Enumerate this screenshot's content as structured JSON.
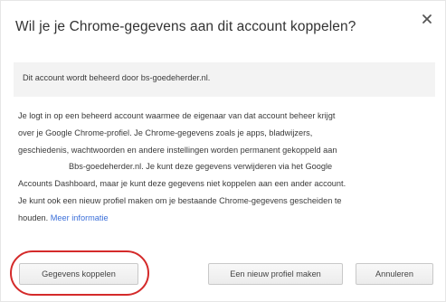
{
  "dialog": {
    "title": "Wil je je Chrome-gegevens aan dit account koppelen?",
    "close_icon": "close-icon",
    "managed_notice": "Dit account wordt beheerd door bs-goedeherder.nl.",
    "body": {
      "line1": "Je logt in op een beheerd account waarmee de eigenaar van dat account beheer krijgt",
      "line2": "over je Google Chrome-profiel. Je Chrome-gegevens zoals je apps, bladwijzers,",
      "line3": "geschiedenis, wachtwoorden en andere instellingen worden permanent gekoppeld aan",
      "line4": "Bbs-goedeherder.nl. Je kunt deze gegevens verwijderen via het Google",
      "line5": "Accounts Dashboard, maar je kunt deze gegevens niet koppelen aan een ander account.",
      "line6": "Je kunt ook een nieuw profiel maken om je bestaande Chrome-gegevens gescheiden te",
      "line7_text": "houden.",
      "link": "Meer informatie"
    },
    "buttons": {
      "connect": "Gegevens koppelen",
      "new_profile": "Een nieuw profiel maken",
      "cancel": "Annuleren"
    },
    "highlight_color": "#d42a2a",
    "link_color": "#3b6fd9"
  }
}
